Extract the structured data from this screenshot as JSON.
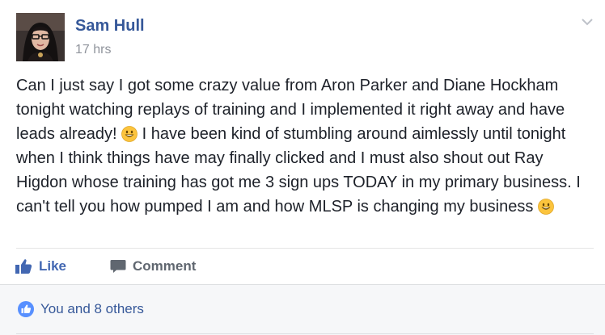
{
  "post": {
    "author": "Sam Hull",
    "timestamp": "17 hrs",
    "text_part1": "Can I just say I got some crazy value from Aron Parker and Diane Hockham tonight watching replays of training and I implemented it right away and have leads already! ",
    "text_part2": " I have been kind of stumbling around aimlessly until tonight when I think things have may finally clicked and I must also shout out Ray Higdon whose training has got me 3 sign ups TODAY in my primary business. I can't tell you how pumped I am and how MLSP is changing my business ",
    "icons": {
      "options": "chevron-down-icon",
      "emoji": "smiley-emoji-icon",
      "like": "thumbs-up-icon",
      "comment": "comment-bubble-icon",
      "reaction": "like-reaction-icon"
    }
  },
  "actions": {
    "like_label": "Like",
    "comment_label": "Comment"
  },
  "reactions": {
    "summary": "You and 8 others"
  },
  "colors": {
    "link": "#365899",
    "like_blue": "#4267b2",
    "text": "#1d2129",
    "muted": "#90949c",
    "footer_bg": "#f6f7f9"
  }
}
